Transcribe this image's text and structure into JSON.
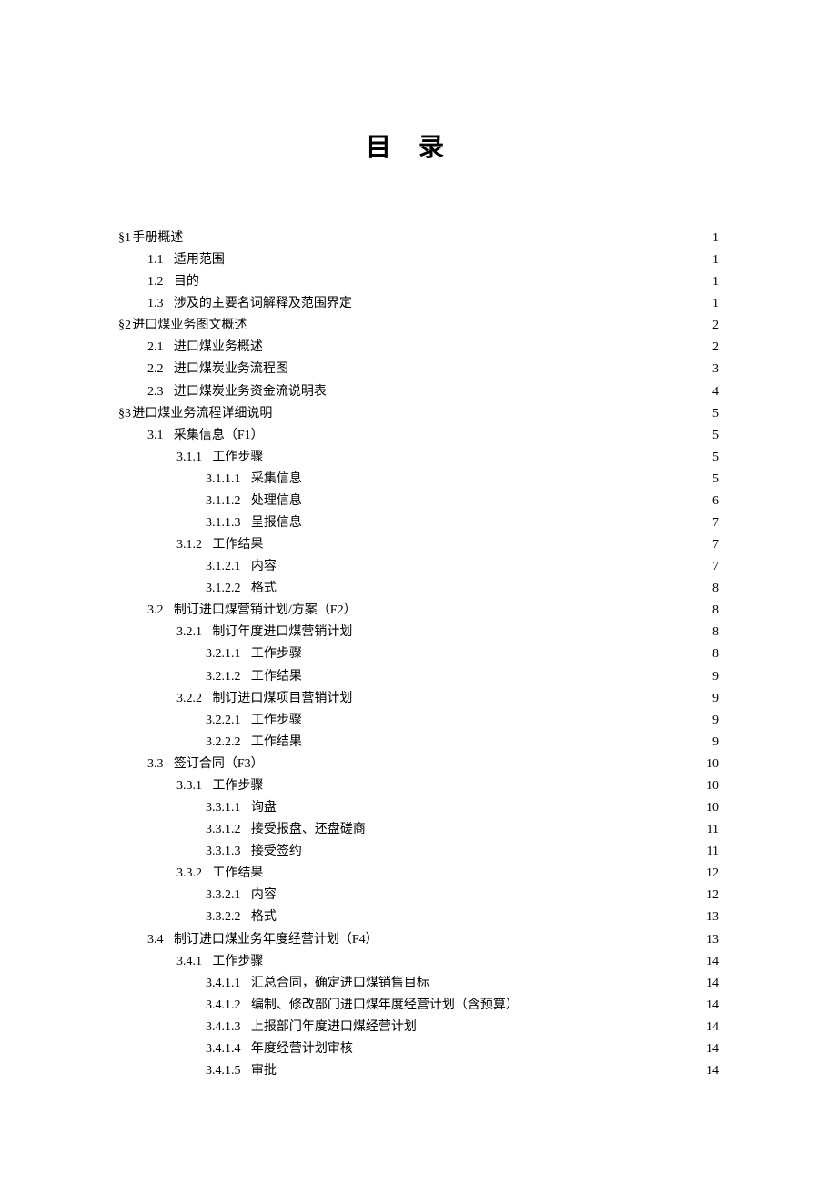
{
  "title": "目录",
  "toc": [
    {
      "level": 0,
      "num": "§1",
      "text": "手册概述",
      "page": "1"
    },
    {
      "level": 1,
      "num": "1.1",
      "text": "适用范围",
      "page": "1"
    },
    {
      "level": 1,
      "num": "1.2",
      "text": "目的",
      "page": "1"
    },
    {
      "level": 1,
      "num": "1.3",
      "text": "涉及的主要名词解释及范围界定",
      "page": "1"
    },
    {
      "level": 0,
      "num": "§2",
      "text": "进口煤业务图文概述",
      "page": "2"
    },
    {
      "level": 1,
      "num": "2.1",
      "text": "进口煤业务概述",
      "page": "2"
    },
    {
      "level": 1,
      "num": "2.2",
      "text": "进口煤炭业务流程图",
      "page": "3"
    },
    {
      "level": 1,
      "num": "2.3",
      "text": "进口煤炭业务资金流说明表",
      "page": "4"
    },
    {
      "level": 0,
      "num": "§3",
      "text": "进口煤业务流程详细说明",
      "page": "5"
    },
    {
      "level": 1,
      "num": "3.1",
      "text": "采集信息（F1）",
      "page": "5"
    },
    {
      "level": 2,
      "num": "3.1.1",
      "text": "工作步骤",
      "page": "5"
    },
    {
      "level": 3,
      "num": "3.1.1.1",
      "text": "采集信息",
      "page": "5"
    },
    {
      "level": 3,
      "num": "3.1.1.2",
      "text": "处理信息",
      "page": "6"
    },
    {
      "level": 3,
      "num": "3.1.1.3",
      "text": "呈报信息",
      "page": "7"
    },
    {
      "level": 2,
      "num": "3.1.2",
      "text": "工作结果",
      "page": "7"
    },
    {
      "level": 3,
      "num": "3.1.2.1",
      "text": "内容",
      "page": "7"
    },
    {
      "level": 3,
      "num": "3.1.2.2",
      "text": "格式",
      "page": "8"
    },
    {
      "level": 1,
      "num": "3.2",
      "text": "制订进口煤营销计划/方案（F2）",
      "page": "8"
    },
    {
      "level": 2,
      "num": "3.2.1",
      "text": "制订年度进口煤营销计划",
      "page": "8"
    },
    {
      "level": 3,
      "num": "3.2.1.1",
      "text": "工作步骤",
      "page": "8"
    },
    {
      "level": 3,
      "num": "3.2.1.2",
      "text": "工作结果",
      "page": "9"
    },
    {
      "level": 2,
      "num": "3.2.2",
      "text": "制订进口煤项目营销计划",
      "page": "9"
    },
    {
      "level": 3,
      "num": "3.2.2.1",
      "text": "工作步骤",
      "page": "9"
    },
    {
      "level": 3,
      "num": "3.2.2.2",
      "text": "工作结果",
      "page": "9"
    },
    {
      "level": 1,
      "num": "3.3",
      "text": "签订合同（F3）",
      "page": "10"
    },
    {
      "level": 2,
      "num": "3.3.1",
      "text": "工作步骤",
      "page": "10"
    },
    {
      "level": 3,
      "num": "3.3.1.1",
      "text": "询盘",
      "page": "10"
    },
    {
      "level": 3,
      "num": "3.3.1.2",
      "text": "接受报盘、还盘磋商",
      "page": "11"
    },
    {
      "level": 3,
      "num": "3.3.1.3",
      "text": "接受签约",
      "page": "11"
    },
    {
      "level": 2,
      "num": "3.3.2",
      "text": "工作结果",
      "page": "12"
    },
    {
      "level": 3,
      "num": "3.3.2.1",
      "text": "内容",
      "page": "12"
    },
    {
      "level": 3,
      "num": "3.3.2.2",
      "text": "格式",
      "page": "13"
    },
    {
      "level": 1,
      "num": "3.4",
      "text": "制订进口煤业务年度经营计划（F4）",
      "page": "13"
    },
    {
      "level": 2,
      "num": "3.4.1",
      "text": "工作步骤",
      "page": "14"
    },
    {
      "level": 3,
      "num": "3.4.1.1",
      "text": "汇总合同，确定进口煤销售目标",
      "page": "14"
    },
    {
      "level": 3,
      "num": "3.4.1.2",
      "text": "编制、修改部门进口煤年度经营计划（含预算）",
      "page": "14"
    },
    {
      "level": 3,
      "num": "3.4.1.3",
      "text": "上报部门年度进口煤经营计划",
      "page": "14"
    },
    {
      "level": 3,
      "num": "3.4.1.4",
      "text": "年度经营计划审核",
      "page": "14"
    },
    {
      "level": 3,
      "num": "3.4.1.5",
      "text": "审批",
      "page": "14"
    }
  ]
}
